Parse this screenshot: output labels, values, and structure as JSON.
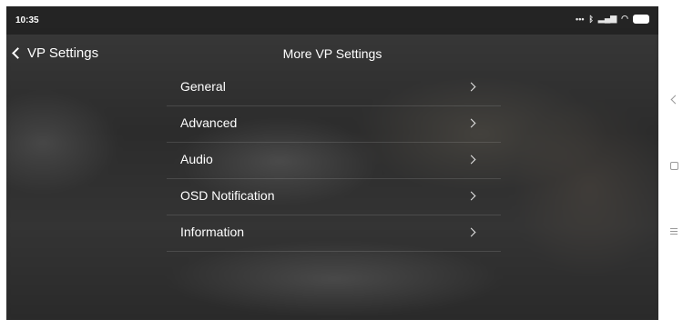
{
  "status_bar": {
    "time": "10:35",
    "icons": [
      "more-dots-icon",
      "bluetooth-icon",
      "signal-icon",
      "wifi-icon",
      "battery-icon"
    ]
  },
  "header": {
    "back_label": "VP Settings",
    "title": "More VP Settings"
  },
  "menu": {
    "items": [
      {
        "label": "General"
      },
      {
        "label": "Advanced"
      },
      {
        "label": "Audio"
      },
      {
        "label": "OSD Notification"
      },
      {
        "label": "Information"
      }
    ]
  },
  "system_nav": {
    "buttons": [
      "back-icon",
      "home-icon",
      "recents-icon"
    ]
  },
  "colors": {
    "text": "#ffffff",
    "divider": "rgba(255,255,255,0.12)",
    "nav_icon": "#999999"
  }
}
